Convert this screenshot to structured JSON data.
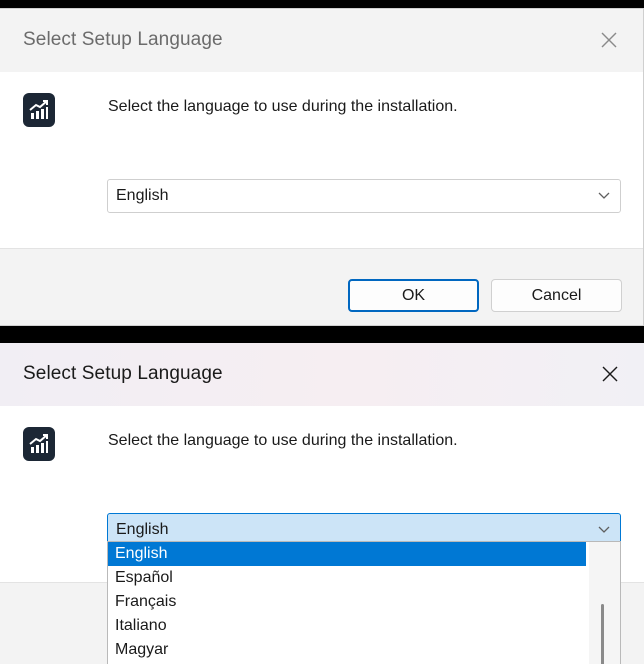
{
  "dialog1": {
    "title": "Select Setup Language",
    "message": "Select the language to use during the installation.",
    "selected_language": "English",
    "ok_label": "OK",
    "cancel_label": "Cancel",
    "icons": {
      "app": "chart-growth-icon",
      "close": "close-icon",
      "dropdown": "chevron-down-icon"
    }
  },
  "dialog2": {
    "title": "Select Setup Language",
    "message": "Select the language to use during the installation.",
    "selected_language": "English",
    "dropdown_open": true,
    "options": [
      "English",
      "Español",
      "Français",
      "Italiano",
      "Magyar"
    ],
    "icons": {
      "app": "chart-growth-icon",
      "close": "close-icon",
      "dropdown": "chevron-down-icon"
    }
  },
  "colors": {
    "accent": "#0078d4",
    "selected_field": "#cce4f7",
    "icon_bg": "#1c2735",
    "surface": "#f3f3f3",
    "content_bg": "#ffffff"
  }
}
